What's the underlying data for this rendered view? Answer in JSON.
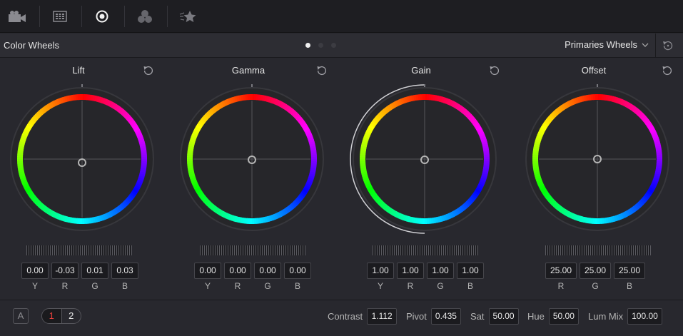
{
  "toolbar": {
    "icons": [
      "camera-icon",
      "grid-icon",
      "target-icon",
      "circles-icon",
      "star-icon"
    ]
  },
  "header": {
    "title": "Color Wheels",
    "mode": "Primaries Wheels"
  },
  "wheels": [
    {
      "title": "Lift",
      "values": [
        "0.00",
        "-0.03",
        "0.01",
        "0.03"
      ],
      "labels": [
        "Y",
        "R",
        "G",
        "B"
      ]
    },
    {
      "title": "Gamma",
      "values": [
        "0.00",
        "0.00",
        "0.00",
        "0.00"
      ],
      "labels": [
        "Y",
        "R",
        "G",
        "B"
      ]
    },
    {
      "title": "Gain",
      "values": [
        "1.00",
        "1.00",
        "1.00",
        "1.00"
      ],
      "labels": [
        "Y",
        "R",
        "G",
        "B"
      ]
    },
    {
      "title": "Offset",
      "values": [
        "25.00",
        "25.00",
        "25.00"
      ],
      "labels": [
        "R",
        "G",
        "B"
      ]
    }
  ],
  "footer": {
    "a_label": "A",
    "pages": [
      "1",
      "2"
    ],
    "contrast_label": "Contrast",
    "contrast": "1.112",
    "pivot_label": "Pivot",
    "pivot": "0.435",
    "sat_label": "Sat",
    "sat": "50.00",
    "hue_label": "Hue",
    "hue": "50.00",
    "lummix_label": "Lum Mix",
    "lummix": "100.00"
  }
}
